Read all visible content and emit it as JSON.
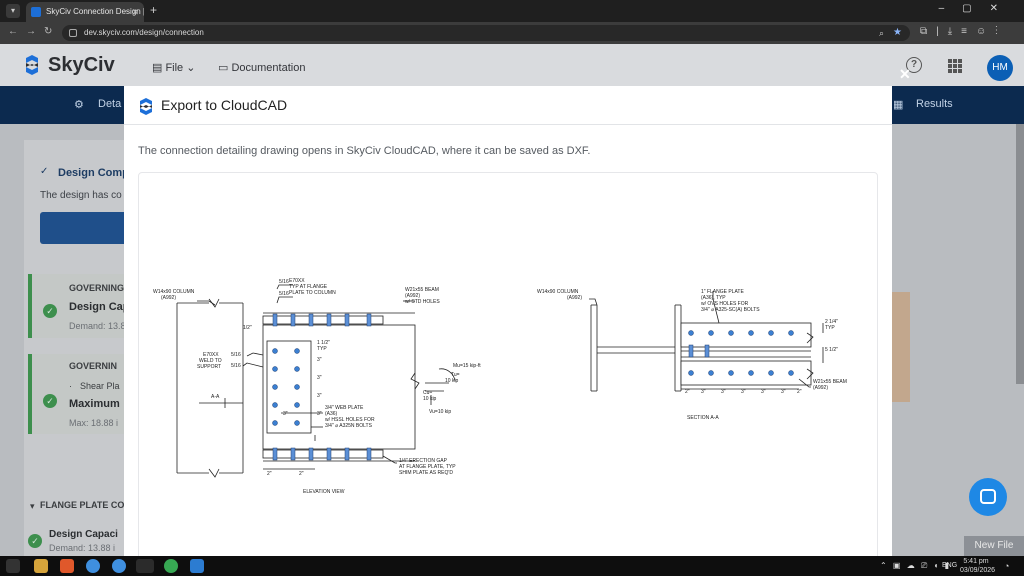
{
  "browser": {
    "tab_title": "SkyCiv Connection Design | Sky",
    "url": "dev.skyciv.com/design/connection"
  },
  "app": {
    "logo": "SkyCiv",
    "menu_file": "File",
    "menu_doc": "Documentation",
    "avatar": "HM",
    "nav_left": "Deta",
    "nav_right": "Results"
  },
  "background": {
    "design_complete": "Design Comp",
    "design_text": "The design has co",
    "governing_1": "GOVERNING",
    "cap_label": "Design Cap",
    "demand_1": "Demand: 13.8",
    "governing_2": "GOVERNIN",
    "shear_item": "Shear Pla",
    "maximum": "Maximum",
    "max_text": "Max: 18.88 i",
    "flange_section": "FLANGE PLATE CO",
    "design_capacity": "Design Capaci",
    "demand_2": "Demand: 13.88 i",
    "new_file": "New File"
  },
  "modal": {
    "title": "Export to CloudCAD",
    "description": "The connection detailing drawing opens in SkyCiv CloudCAD, where it can be saved as DXF."
  },
  "drawing": {
    "elev": {
      "column": "W14x90 COLUMN",
      "column_grade": "(A992)",
      "weld_a": "5/16",
      "weld_b": "5/16",
      "e70xx_top": "E70XX",
      "typ_flange": "TYP AT FLANGE",
      "plate_to_col": "PLATE TO COLUMN",
      "beam": "W21x55 BEAM",
      "beam_grade": "(A992)",
      "std_holes": "w/ STD HOLES",
      "half": "1/2\"",
      "e70xx_left": "E70XX",
      "weld_to": "WELD TO",
      "support": "SUPPORT",
      "weld_c": "5/16",
      "weld_d": "5/16",
      "edge_1": "1 1/2\"",
      "typ": "TYP",
      "pitch": "3\"",
      "gauge": "3\"",
      "aa": "A-A",
      "web_plate": "3/4\" WEB PLATE",
      "web_grade": "(A36)",
      "hssl": "w/ HSSL HOLES FOR",
      "a325n": "3/4\" ⌀ A325N BOLTS",
      "mu": "Mu=15 kip-ft",
      "tu": "Tu=",
      "tu_val": "10 kip",
      "cu": "Cu=",
      "cu_val": "10 kip",
      "vu": "Vu=10 kip",
      "gap": "1/4\" ERECTION GAP",
      "gap_at": "AT FLANGE PLATE, TYP",
      "shim": "SHIM PLATE AS REQ'D",
      "bottom_dim": "2\"",
      "caption": "ELEVATION VIEW"
    },
    "section": {
      "column": "W14x90 COLUMN",
      "column_grade": "(A992)",
      "flange_plate": "1\" FLANGE PLATE",
      "flange_grade": "(A36), TYP",
      "ovs": "w/ OVS HOLES FOR",
      "a325sc": "3/4\" ⌀ A325-SC(A) BOLTS",
      "dim_top": "2 1/4\"",
      "dim_typ": "TYP",
      "dim_mid": "5 1/2\"",
      "beam": "W21x55 BEAM",
      "beam_grade": "(A992)",
      "dim_2": "2\"",
      "dim_3": "3\"",
      "caption": "SECTION A-A"
    }
  },
  "taskbar": {
    "lang": "ENG",
    "time": "5:41 pm",
    "date": "03/09/2026"
  },
  "colors": {
    "primary": "#1d6fd8",
    "nav_dark": "#0c2a4f",
    "success": "#3d8f4d",
    "bolt_fill": "#3b7fd1",
    "plate_blue": "#5b8fd6"
  }
}
